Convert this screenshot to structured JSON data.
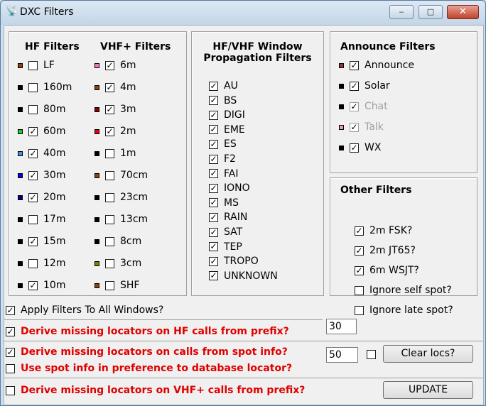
{
  "window": {
    "title": "DXC Filters",
    "minimize_glyph": "‒",
    "maximize_glyph": "□",
    "close_glyph": "✕"
  },
  "hf": {
    "title": "HF Filters",
    "items": [
      {
        "label": "LF",
        "checked": false,
        "color": "#8b4513"
      },
      {
        "label": "160m",
        "checked": false,
        "color": "#000000"
      },
      {
        "label": "80m",
        "checked": false,
        "color": "#000000"
      },
      {
        "label": "60m",
        "checked": true,
        "color": "#22cc22"
      },
      {
        "label": "40m",
        "checked": true,
        "color": "#4a90e2"
      },
      {
        "label": "30m",
        "checked": true,
        "color": "#0000ee"
      },
      {
        "label": "20m",
        "checked": true,
        "color": "#000080"
      },
      {
        "label": "17m",
        "checked": false,
        "color": "#000000"
      },
      {
        "label": "15m",
        "checked": true,
        "color": "#000000"
      },
      {
        "label": "12m",
        "checked": false,
        "color": "#000000"
      },
      {
        "label": "10m",
        "checked": true,
        "color": "#000000"
      }
    ]
  },
  "vhf": {
    "title": "VHF+ Filters",
    "items": [
      {
        "label": "6m",
        "checked": true,
        "color": "#ee77bb"
      },
      {
        "label": "4m",
        "checked": true,
        "color": "#8b4513"
      },
      {
        "label": "3m",
        "checked": true,
        "color": "#8b0000"
      },
      {
        "label": "2m",
        "checked": true,
        "color": "#ee0000"
      },
      {
        "label": "1m",
        "checked": false,
        "color": "#000000"
      },
      {
        "label": "70cm",
        "checked": false,
        "color": "#8b4513"
      },
      {
        "label": "23cm",
        "checked": false,
        "color": "#000000"
      },
      {
        "label": "13cm",
        "checked": false,
        "color": "#000000"
      },
      {
        "label": "8cm",
        "checked": false,
        "color": "#000000"
      },
      {
        "label": "3cm",
        "checked": false,
        "color": "#808000"
      },
      {
        "label": "SHF",
        "checked": false,
        "color": "#8b4513"
      }
    ]
  },
  "prop": {
    "title_line1": "HF/VHF Window",
    "title_line2": "Propagation Filters",
    "items": [
      {
        "label": "AU",
        "checked": true
      },
      {
        "label": "BS",
        "checked": true
      },
      {
        "label": "DIGI",
        "checked": true
      },
      {
        "label": "EME",
        "checked": true
      },
      {
        "label": "ES",
        "checked": true
      },
      {
        "label": "F2",
        "checked": true
      },
      {
        "label": "FAI",
        "checked": true
      },
      {
        "label": "IONO",
        "checked": true
      },
      {
        "label": "MS",
        "checked": true
      },
      {
        "label": "RAIN",
        "checked": true
      },
      {
        "label": "SAT",
        "checked": true
      },
      {
        "label": "TEP",
        "checked": true
      },
      {
        "label": "TROPO",
        "checked": true
      },
      {
        "label": "UNKNOWN",
        "checked": true
      }
    ]
  },
  "announce": {
    "title": "Announce Filters",
    "items": [
      {
        "label": "Announce",
        "checked": true,
        "color": "#8b3a3a",
        "disabled": false
      },
      {
        "label": "Solar",
        "checked": true,
        "color": "#000000",
        "disabled": false
      },
      {
        "label": "Chat",
        "checked": true,
        "color": "#000000",
        "disabled": true
      },
      {
        "label": "Talk",
        "checked": true,
        "color": "#ee99aa",
        "disabled": true
      },
      {
        "label": "WX",
        "checked": true,
        "color": "#000000",
        "disabled": false
      }
    ]
  },
  "other": {
    "title": "Other Filters",
    "items": [
      {
        "label": "2m FSK?",
        "checked": true
      },
      {
        "label": "2m JT65?",
        "checked": true
      },
      {
        "label": "6m WSJT?",
        "checked": true
      },
      {
        "label": "Ignore self spot?",
        "checked": false
      },
      {
        "label": "Ignore late spot?",
        "checked": false
      }
    ]
  },
  "bottom": {
    "apply_all": {
      "label": "Apply Filters To All Windows?",
      "checked": true
    },
    "derive_hf": {
      "label": "Derive missing locators on HF calls from prefix?",
      "checked": true
    },
    "hf_value": "30",
    "derive_spot": {
      "label": "Derive missing locators on calls from spot info?",
      "checked": true
    },
    "spot_value": "50",
    "spot_extra_checked": false,
    "clear_locs_label": "Clear locs?",
    "use_spot": {
      "label": "Use spot info in preference to database locator?",
      "checked": false
    },
    "derive_vhf": {
      "label": "Derive missing locators on VHF+ calls from prefix?",
      "checked": false
    },
    "update_label": "UPDATE"
  }
}
